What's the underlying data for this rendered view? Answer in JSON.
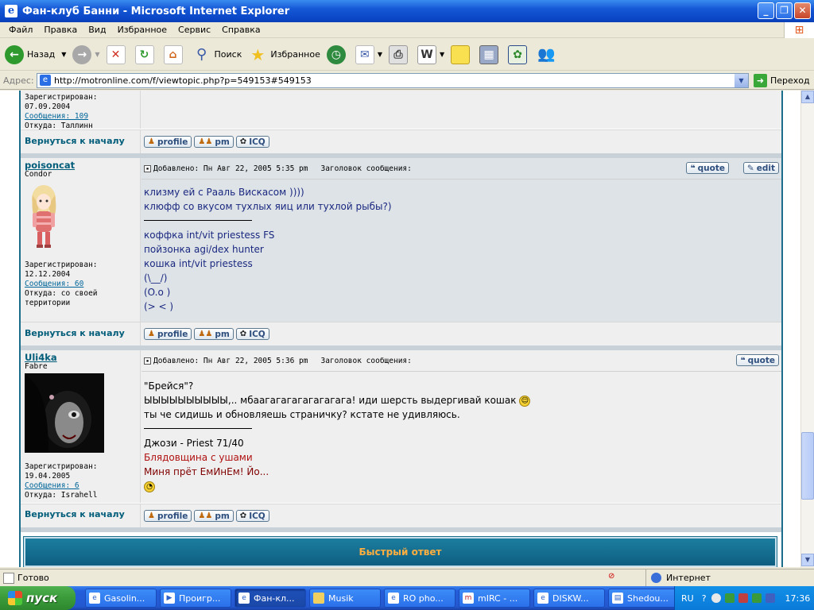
{
  "window": {
    "title": "Фан-клуб Банни - Microsoft Internet Explorer",
    "min": "_",
    "max": "❐",
    "close": "✕"
  },
  "menu": [
    "Файл",
    "Правка",
    "Вид",
    "Избранное",
    "Сервис",
    "Справка"
  ],
  "toolbar": {
    "back": "Назад",
    "search": "Поиск",
    "favorites": "Избранное"
  },
  "address": {
    "label": "Адрес:",
    "url": "http://motronline.com/f/viewtopic.php?p=549153#549153",
    "go": "Переход"
  },
  "forum": {
    "back_to_top": "Вернуться к началу",
    "buttons": {
      "profile": "profile",
      "pm": "pm",
      "icq": "ICQ",
      "quote": "quote",
      "edit": "edit"
    },
    "subject_label": "Заголовок сообщения:",
    "quick_reply": "Быстрый ответ",
    "prev": {
      "reg_label": "Зарегистрирован:",
      "reg_date": "07.09.2004",
      "posts": "Сообщения: 109",
      "from": "Откуда: Таллинн"
    },
    "posts": [
      {
        "user": "poisoncat",
        "rank": "Condor",
        "reg_label": "Зарегистрирован:",
        "reg_date": "12.12.2004",
        "posts": "Сообщения: 60",
        "from": "Откуда: со своей территории",
        "date": "Добавлено: Пн Авг 22, 2005 5:35 pm",
        "lines": [
          "клизму ей с Рааль Вискасом ))))",
          "клюфф со вкусом тухлых яиц или тухлой рыбы?)"
        ],
        "sig": [
          "коффка int/vit priestess FS",
          "пойзонка agi/dex hunter",
          "кошка int/vit priestess",
          "(\\__/)",
          "(O.o )",
          "(> < )"
        ]
      },
      {
        "user": "Uli4ka",
        "rank": "Fabre",
        "reg_label": "Зарегистрирован:",
        "reg_date": "19.04.2005",
        "posts": "Сообщения: 6",
        "from": "Откуда: Israhell",
        "date": "Добавлено: Пн Авг 22, 2005 5:36 pm",
        "lines": [
          "\"Брейся\"?",
          "ЫЫЫЫЫЫЫЫЫЫ,.. мбаагагагагагагагага! иди шерсть выдергивай кошак",
          "ты че сидишь и обновляешь страничку? кстате не удивляюсь."
        ],
        "sig": [
          "Джози - Priest 71/40",
          "Блядовщина с ушами",
          "Миня прёт ЕмИнЕм! Йо..."
        ]
      }
    ]
  },
  "status": {
    "text": "Готово",
    "zone": "Интернет"
  },
  "taskbar": {
    "start": "пуск",
    "tasks": [
      "Gasolin...",
      "Проигр...",
      "Фан-кл...",
      "Musik",
      "RO pho...",
      "mIRC - ...",
      "DISKW...",
      "Shedou..."
    ],
    "lang": "RU",
    "clock": "17:36"
  }
}
